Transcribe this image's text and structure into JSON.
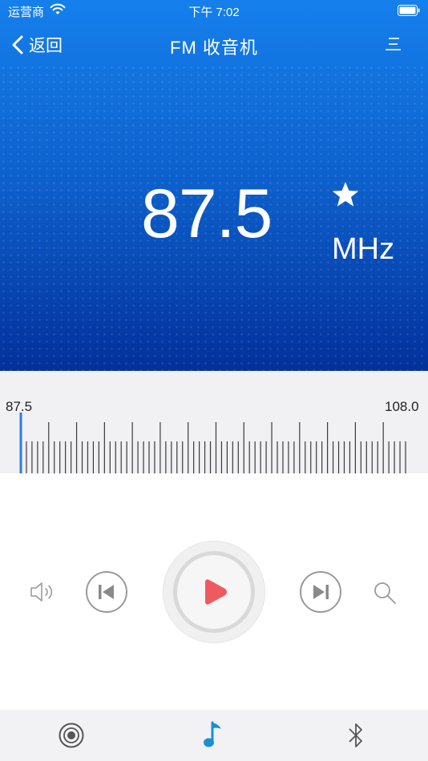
{
  "status_bar": {
    "carrier": "运营商",
    "time": "下午 7:02"
  },
  "nav": {
    "back_label": "返回",
    "title": "FM 收音机"
  },
  "radio": {
    "frequency": "87.5",
    "unit": "MHz"
  },
  "scale": {
    "min_label": "87.5",
    "max_label": "108.0",
    "current_frequency": 87.5,
    "range": [
      87.5,
      108.0
    ]
  },
  "colors": {
    "header_top": "#1580ec",
    "header_bottom": "#03309b",
    "play_accent": "#ee5a5f",
    "indicator": "#2b7fe0",
    "music_tab": "#1a8fd6"
  },
  "icons": {
    "back": "chevron-left-icon",
    "menu": "menu-icon",
    "favorite": "star-icon",
    "volume": "speaker-icon",
    "previous": "skip-previous-icon",
    "play": "play-icon",
    "next": "skip-next-icon",
    "search": "search-icon",
    "tabs": [
      "radio-icon",
      "music-note-icon",
      "bluetooth-icon"
    ]
  }
}
